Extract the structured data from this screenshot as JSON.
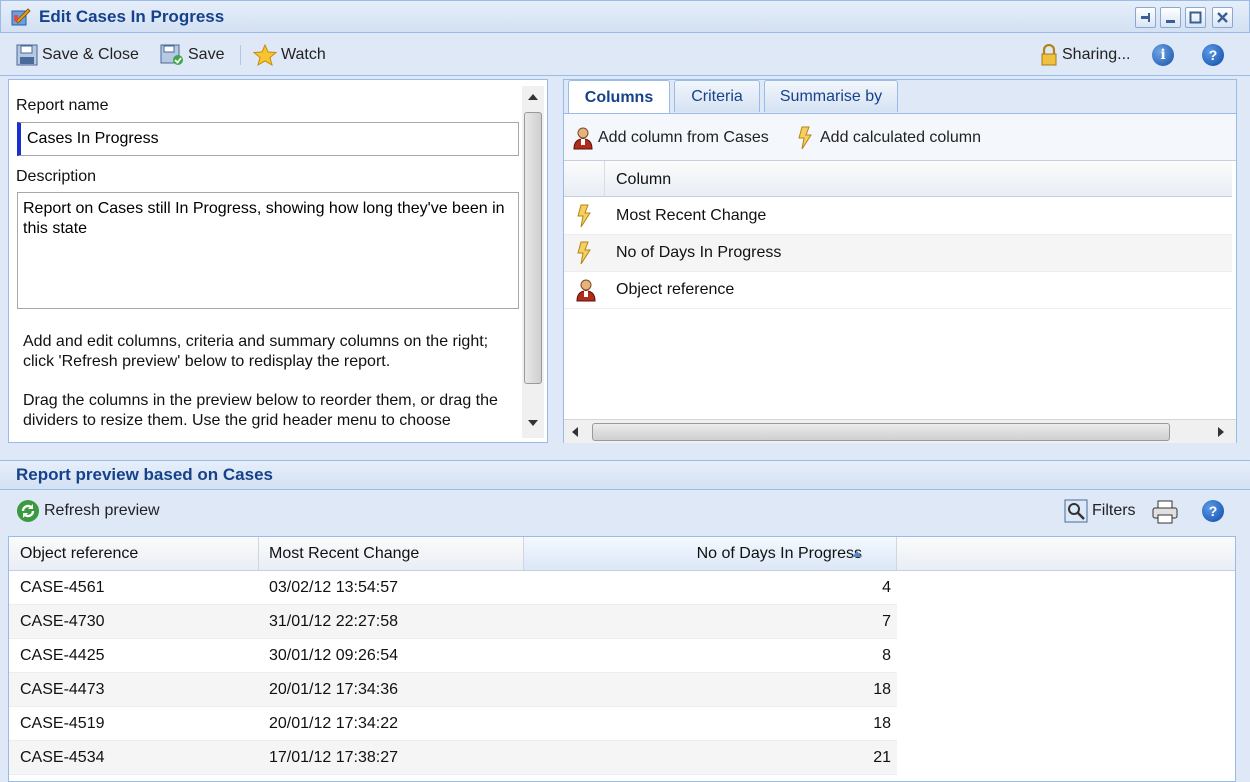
{
  "window": {
    "title": "Edit Cases In Progress"
  },
  "toolbar": {
    "save_close": "Save & Close",
    "save": "Save",
    "watch": "Watch",
    "sharing": "Sharing..."
  },
  "left": {
    "report_name_label": "Report name",
    "report_name_value": "Cases In Progress",
    "description_label": "Description",
    "description_value": "Report on Cases still In Progress, showing how long they've been in this state",
    "help_para1": "Add and edit columns, criteria and summary columns on the right; click 'Refresh preview' below to redisplay the report.",
    "help_para2": "Drag the columns in the preview below to reorder them, or drag the dividers to resize them. Use the grid header menu to choose"
  },
  "right": {
    "tabs": [
      "Columns",
      "Criteria",
      "Summarise by"
    ],
    "add_column": "Add column from Cases",
    "add_calculated": "Add calculated column",
    "column_header": "Column",
    "columns": [
      {
        "icon": "lightning-icon",
        "label": "Most Recent Change"
      },
      {
        "icon": "lightning-icon",
        "label": "No of Days In Progress"
      },
      {
        "icon": "person-icon",
        "label": "Object reference"
      }
    ]
  },
  "preview": {
    "title": "Report preview based on Cases",
    "refresh": "Refresh preview",
    "filters": "Filters",
    "headers": [
      "Object reference",
      "Most Recent Change",
      "No of Days In Progress"
    ],
    "rows": [
      [
        "CASE-4561",
        "03/02/12 13:54:57",
        "4"
      ],
      [
        "CASE-4730",
        "31/01/12 22:27:58",
        "7"
      ],
      [
        "CASE-4425",
        "30/01/12 09:26:54",
        "8"
      ],
      [
        "CASE-4473",
        "20/01/12 17:34:36",
        "18"
      ],
      [
        "CASE-4519",
        "20/01/12 17:34:22",
        "18"
      ],
      [
        "CASE-4534",
        "17/01/12 17:38:27",
        "21"
      ]
    ]
  }
}
